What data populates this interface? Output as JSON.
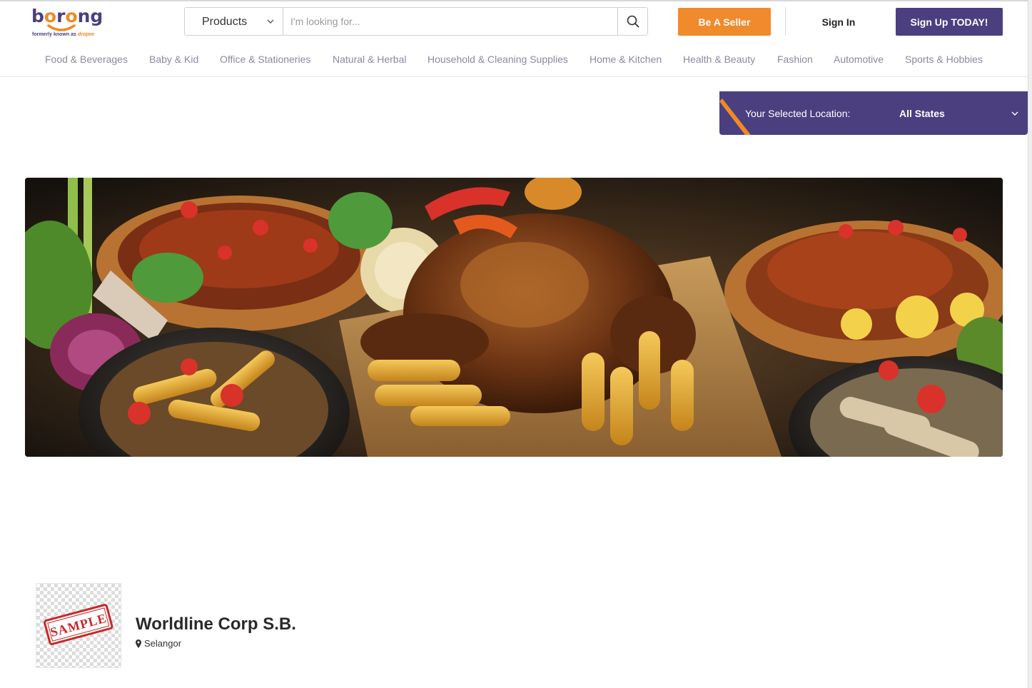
{
  "header": {
    "logo": {
      "word": "borong",
      "tagline_prefix": "formerly known as",
      "tagline_brand": "dropee"
    },
    "search": {
      "category": "Products",
      "placeholder": "I'm looking for..."
    },
    "seller_button": "Be A Seller",
    "signin_button": "Sign In",
    "signup_button": "Sign Up TODAY!"
  },
  "categories": [
    "Food & Beverages",
    "Baby & Kid",
    "Office & Stationeries",
    "Natural & Herbal",
    "Household & Cleaning Supplies",
    "Home & Kitchen",
    "Health & Beauty",
    "Fashion",
    "Automotive",
    "Sports & Hobbies"
  ],
  "location": {
    "label": "Your Selected Location:",
    "value": "All States"
  },
  "store": {
    "name": "Worldline Corp S.B.",
    "state": "Selangor",
    "logo_stamp": "SAMPLE"
  },
  "colors": {
    "brand_purple": "#4b3f80",
    "brand_orange": "#f08a2c"
  },
  "icons": [
    "chevron-down-icon",
    "search-icon",
    "map-pin-icon"
  ]
}
